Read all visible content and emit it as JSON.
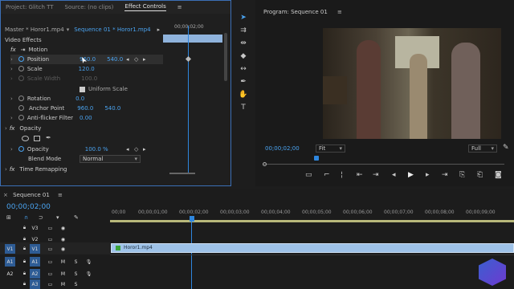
{
  "left_panel": {
    "tabs": [
      "Project: Glitch TT",
      "Source: (no clips)",
      "Effect Controls"
    ],
    "master_clip": "Master * Horor1.mp4",
    "seq_clip": "Sequence 01 * Horor1.mp4",
    "timecode": "00;00;02;00",
    "section": "Video Effects",
    "motion": "Motion",
    "position_label": "Position",
    "position_x": "960.0",
    "position_y": "540.0",
    "scale_label": "Scale",
    "scale_val": "120.0",
    "scale_width_label": "Scale Width",
    "scale_width_val": "100.0",
    "uniform_scale": "Uniform Scale",
    "rotation_label": "Rotation",
    "rotation_val": "0.0",
    "anchor_label": "Anchor Point",
    "anchor_x": "960.0",
    "anchor_y": "540.0",
    "antiflicker_label": "Anti-flicker Filter",
    "antiflicker_val": "0.00",
    "opacity": "Opacity",
    "opacity_label": "Opacity",
    "opacity_val": "100.0 %",
    "blend_label": "Blend Mode",
    "blend_val": "Normal",
    "time_remap": "Time Remapping"
  },
  "program": {
    "title": "Program: Sequence 01",
    "timecode": "00;00;02;00",
    "fit": "Fit",
    "quality": "Full"
  },
  "timeline": {
    "title": "Sequence 01",
    "timecode": "00;00;02;00",
    "ruler": [
      "00;00",
      "00;00;01;00",
      "00;00;02;00",
      "00;00;03;00",
      "00;00;04;00",
      "00;00;05;00",
      "00;00;06;00",
      "00;00;07;00",
      "00;00;08;00",
      "00;00;09;00"
    ],
    "clip_name": "Horor1.mp4",
    "tracks": {
      "v1": "V1",
      "v2": "V2",
      "v3": "V3",
      "a1": "A1",
      "a2": "A2",
      "a3": "A3",
      "a1b": "A1",
      "a2b": "A2",
      "m": "M",
      "s": "S"
    }
  },
  "colors": {
    "accent": "#4aa3f0",
    "clip": "#9ec2e8",
    "playhead": "#2e86de"
  }
}
